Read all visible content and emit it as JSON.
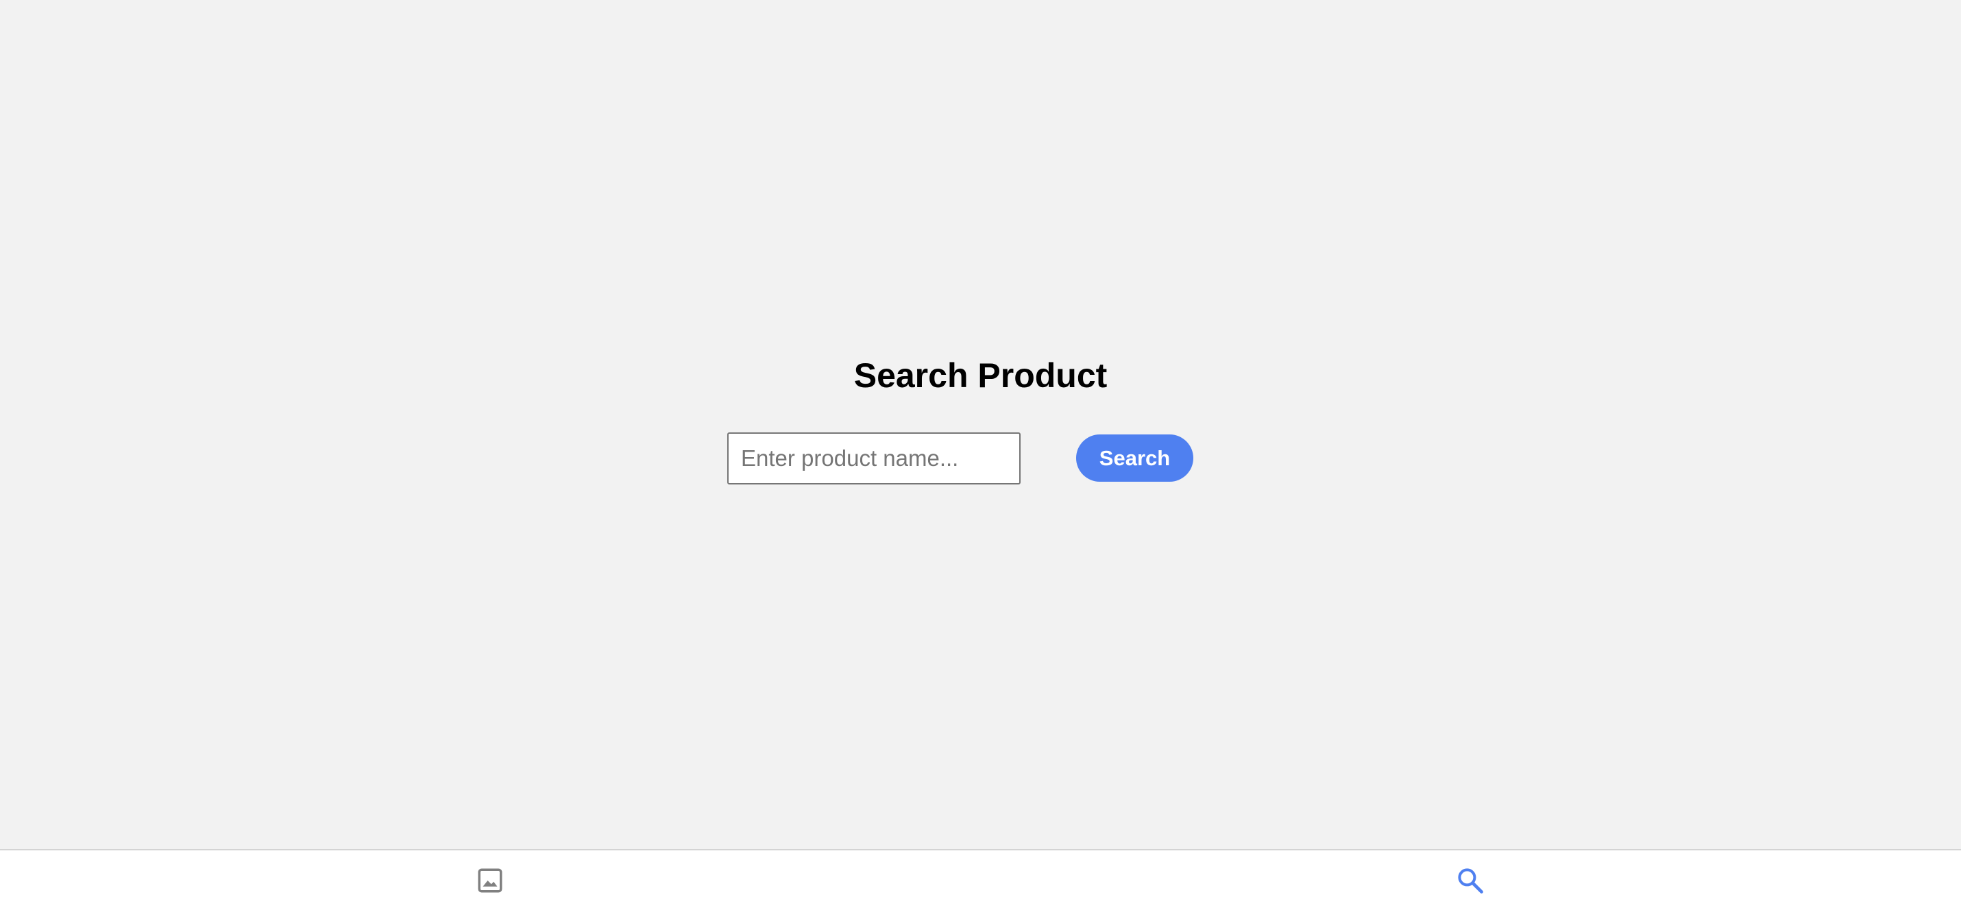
{
  "main": {
    "title": "Search Product",
    "search": {
      "placeholder": "Enter product name...",
      "value": "",
      "button_label": "Search"
    }
  },
  "bottom_nav": {
    "items": [
      {
        "icon": "image-icon",
        "active": false,
        "color": "#808080"
      },
      {
        "icon": "search-icon",
        "active": true,
        "color": "#4f80f0"
      }
    ]
  },
  "colors": {
    "background": "#f2f2f2",
    "accent": "#4f80f0",
    "nav_background": "#ffffff"
  }
}
